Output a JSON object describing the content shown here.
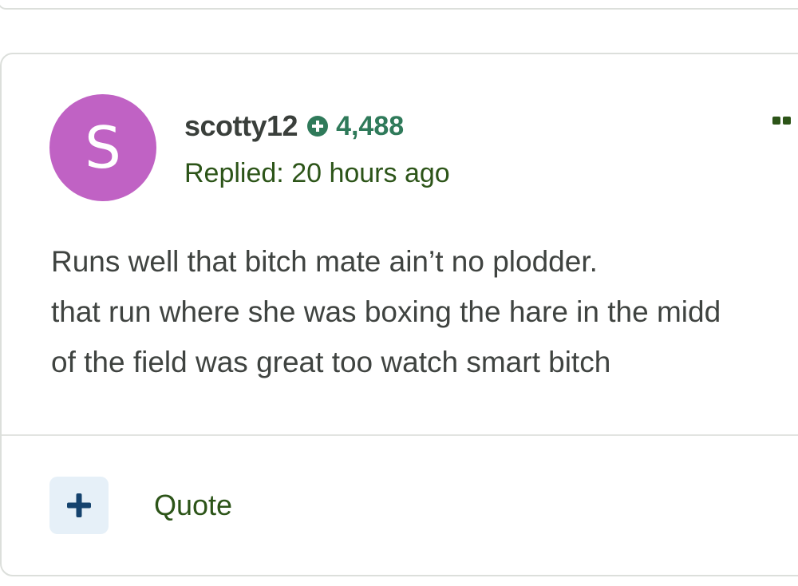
{
  "post": {
    "avatar_letter": "S",
    "avatar_color": "#c062c4",
    "username": "scotty12",
    "points": "4,488",
    "points_icon": "plus-circle-icon",
    "replied": "Replied: 20 hours ago",
    "body_lines": [
      "Runs well that bitch mate ain’t no plodder.",
      "that run where she was boxing the hare in the midd",
      "of the field was great too watch smart bitch"
    ]
  },
  "actions": {
    "add_icon": "plus-icon",
    "quote_label": "Quote"
  },
  "colors": {
    "accent_green": "#2c5418",
    "points_green": "#2f7a5a",
    "add_button_bg": "#e6f0f8",
    "add_button_fg": "#15436e"
  }
}
